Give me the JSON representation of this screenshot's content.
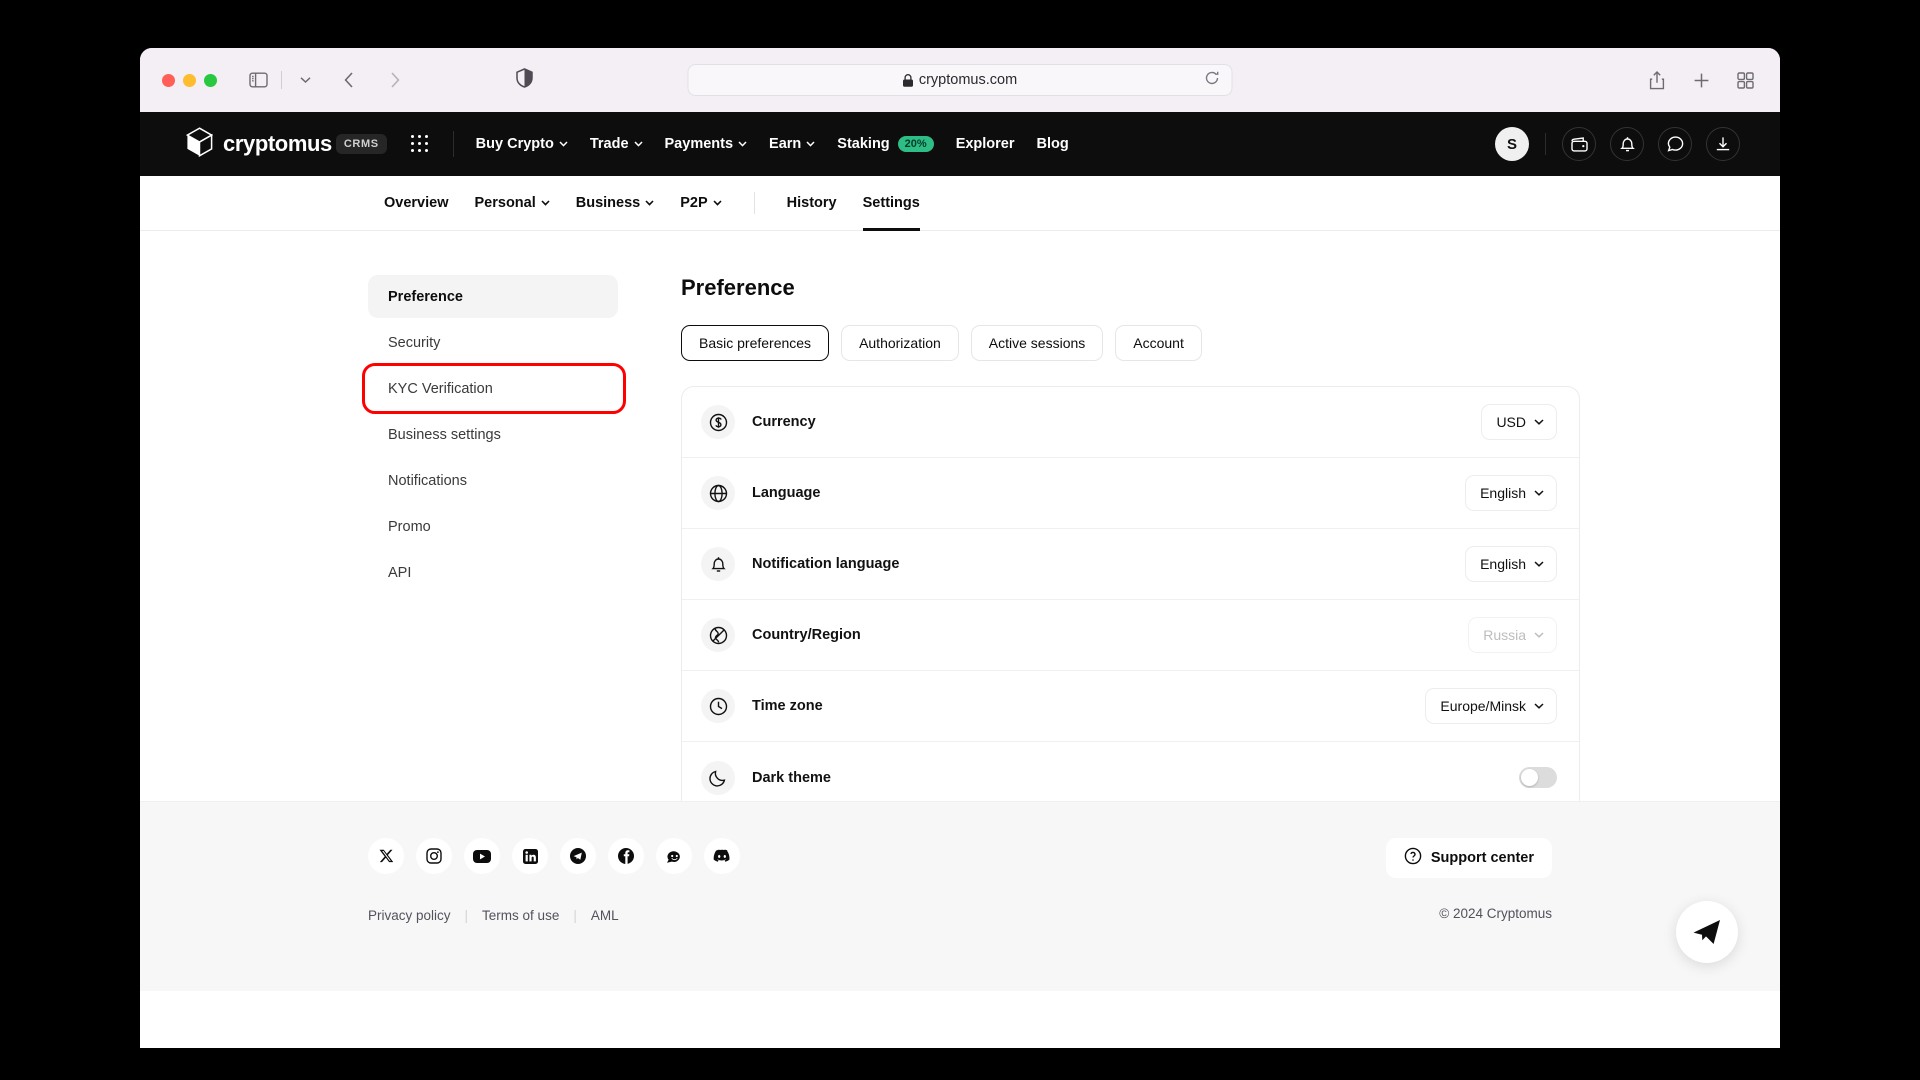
{
  "browser": {
    "url": "cryptomus.com",
    "lock_icon": "lock-icon",
    "reload_icon": "reload-icon",
    "shield_icon": "privacy-shield-icon",
    "sidebar_icon": "sidebar-toggle-icon",
    "back_icon": "back-arrow-icon",
    "forward_icon": "forward-arrow-icon",
    "share_icon": "share-icon",
    "newtab_icon": "plus-icon",
    "tabs_icon": "tab-overview-icon"
  },
  "header": {
    "brand": "cryptomus",
    "brand_badge": "CRMS",
    "apps_icon": "app-grid-icon",
    "nav": [
      {
        "label": "Buy Crypto",
        "caret": true
      },
      {
        "label": "Trade",
        "caret": true
      },
      {
        "label": "Payments",
        "caret": true
      },
      {
        "label": "Earn",
        "caret": true
      },
      {
        "label": "Staking",
        "caret": false,
        "badge": "20%"
      },
      {
        "label": "Explorer",
        "caret": false
      },
      {
        "label": "Blog",
        "caret": false
      }
    ],
    "avatar_initial": "S",
    "icons": [
      "wallet-icon",
      "bell-icon",
      "chat-icon",
      "download-icon"
    ],
    "badge_color": "#2ebd85"
  },
  "subnav": {
    "items": [
      {
        "label": "Overview",
        "caret": false,
        "active": false
      },
      {
        "label": "Personal",
        "caret": true,
        "active": false
      },
      {
        "label": "Business",
        "caret": true,
        "active": false
      },
      {
        "label": "P2P",
        "caret": true,
        "active": false
      },
      {
        "label": "History",
        "caret": false,
        "active": false
      },
      {
        "label": "Settings",
        "caret": false,
        "active": true
      }
    ]
  },
  "sidebar": {
    "items": [
      {
        "label": "Preference",
        "active": true,
        "annotated": false
      },
      {
        "label": "Security",
        "active": false,
        "annotated": false
      },
      {
        "label": "KYC Verification",
        "active": false,
        "annotated": true
      },
      {
        "label": "Business settings",
        "active": false,
        "annotated": false
      },
      {
        "label": "Notifications",
        "active": false,
        "annotated": false
      },
      {
        "label": "Promo",
        "active": false,
        "annotated": false
      },
      {
        "label": "API",
        "active": false,
        "annotated": false
      }
    ],
    "annotation_color": "#ff0000"
  },
  "main": {
    "title": "Preference",
    "tabs": [
      {
        "label": "Basic preferences",
        "active": true
      },
      {
        "label": "Authorization",
        "active": false
      },
      {
        "label": "Active sessions",
        "active": false
      },
      {
        "label": "Account",
        "active": false
      }
    ],
    "rows": [
      {
        "icon": "dollar-circle-icon",
        "label": "Currency",
        "control": "select",
        "value": "USD",
        "disabled": false
      },
      {
        "icon": "globe-icon",
        "label": "Language",
        "control": "select",
        "value": "English",
        "disabled": false
      },
      {
        "icon": "bell-icon",
        "label": "Notification language",
        "control": "select",
        "value": "English",
        "disabled": false
      },
      {
        "icon": "globe-off-icon",
        "label": "Country/Region",
        "control": "select",
        "value": "Russia",
        "disabled": true
      },
      {
        "icon": "clock-icon",
        "label": "Time zone",
        "control": "select",
        "value": "Europe/Minsk",
        "disabled": false
      },
      {
        "icon": "moon-icon",
        "label": "Dark theme",
        "control": "toggle",
        "value": "off",
        "disabled": false
      }
    ]
  },
  "footer": {
    "socials": [
      "x-icon",
      "instagram-icon",
      "youtube-icon",
      "linkedin-icon",
      "telegram-icon",
      "facebook-icon",
      "reddit-icon",
      "discord-icon"
    ],
    "links": [
      "Privacy policy",
      "Terms of use",
      "AML"
    ],
    "support_label": "Support center",
    "support_icon": "question-circle-icon",
    "copyright": "© 2024 Cryptomus",
    "fab_icon": "telegram-send-icon"
  }
}
